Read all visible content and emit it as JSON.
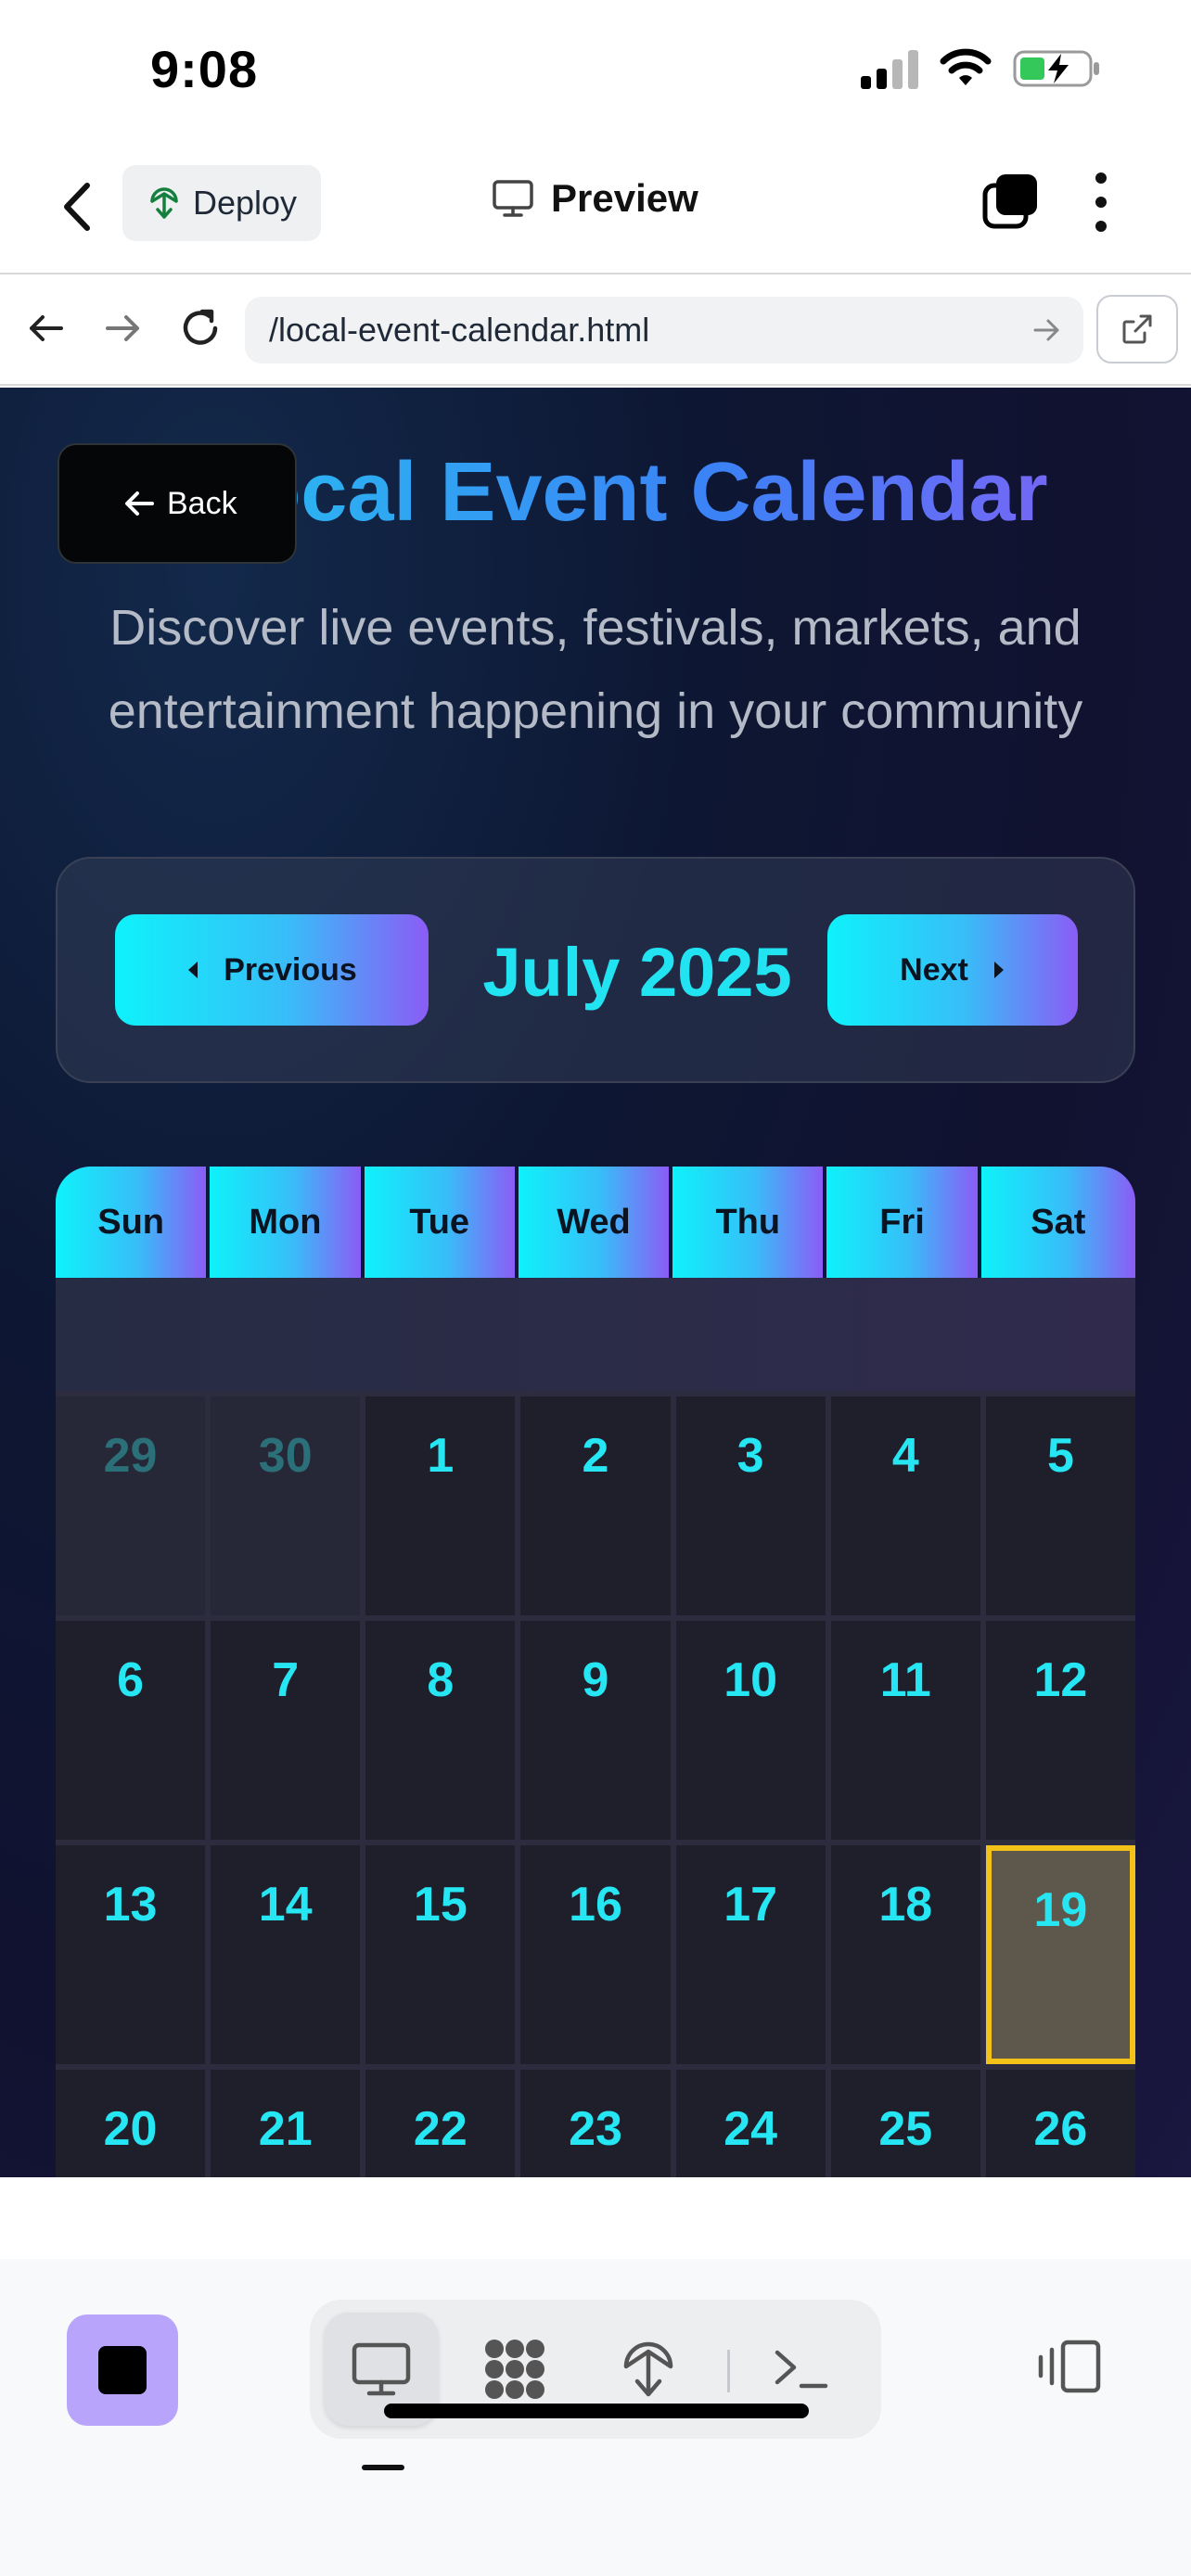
{
  "status_bar": {
    "time": "9:08"
  },
  "app_header": {
    "deploy_label": "Deploy",
    "title": "Preview"
  },
  "browser": {
    "url": "/local-event-calendar.html"
  },
  "page": {
    "title": "Local Event Calendar",
    "back_label": "Back",
    "subtitle_line1": "Discover live events, festivals, markets, and",
    "subtitle_line2": "entertainment happening in your community",
    "prev_label": "Previous",
    "next_label": "Next",
    "month_label": "July 2025",
    "weekdays": [
      "Sun",
      "Mon",
      "Tue",
      "Wed",
      "Thu",
      "Fri",
      "Sat"
    ],
    "days": [
      "29",
      "30",
      "1",
      "2",
      "3",
      "4",
      "5",
      "6",
      "7",
      "8",
      "9",
      "10",
      "11",
      "12",
      "13",
      "14",
      "15",
      "16",
      "17",
      "18",
      "19",
      "20",
      "21",
      "22",
      "23",
      "24",
      "25",
      "26"
    ],
    "highlighted_day": "19",
    "colors": {
      "accent_cyan": "#22e3f2",
      "accent_purple": "#8b5cf6",
      "today_border": "#f2c21b"
    }
  },
  "toolbar": {
    "icons": [
      "stop-icon",
      "monitor-icon",
      "grid-icon",
      "deploy-icon",
      "terminal-icon",
      "layout-icon"
    ]
  }
}
